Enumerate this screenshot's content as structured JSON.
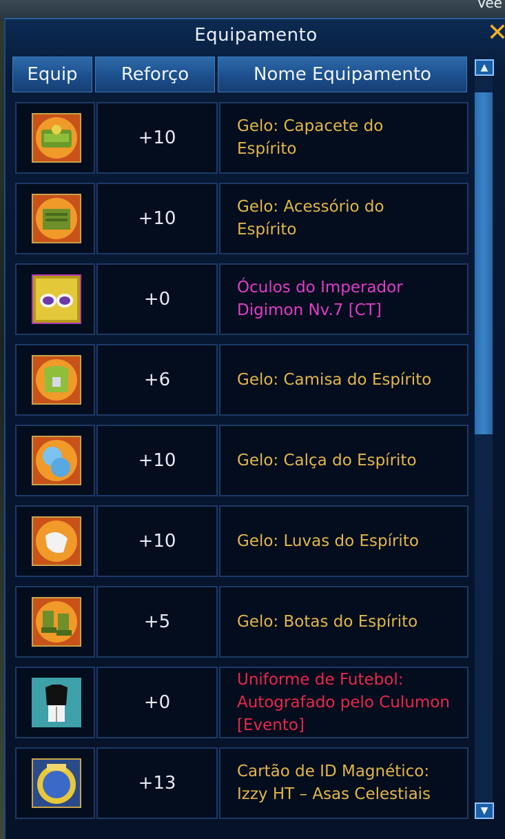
{
  "window": {
    "title": "Equipamento",
    "close_icon": "close-icon"
  },
  "background": {
    "peek_text": "Vee"
  },
  "headers": {
    "equip": "Equip",
    "reforco": "Reforço",
    "nome": "Nome Equipamento"
  },
  "colors": {
    "normal": "#e1b64a",
    "magenta": "#e23cc8",
    "red": "#e8284a",
    "enhance": "#e8ecf2",
    "header_bg": "#1c4f8d",
    "title": "#e9eef6",
    "close": "#f1b02a"
  },
  "items": [
    {
      "icon": "helmet-icon",
      "reforco": "+10",
      "lines": [
        "Gelo: Capacete do",
        "Espírito"
      ],
      "color": "normal"
    },
    {
      "icon": "accessory-icon",
      "reforco": "+10",
      "lines": [
        "Gelo: Acessório do",
        "Espírito"
      ],
      "color": "normal"
    },
    {
      "icon": "goggles-icon",
      "reforco": "+0",
      "lines": [
        "Óculos do Imperador",
        "Digimon Nv.7 [CT]"
      ],
      "color": "magenta"
    },
    {
      "icon": "shirt-icon",
      "reforco": "+6",
      "lines": [
        "Gelo: Camisa do Espírito"
      ],
      "color": "normal"
    },
    {
      "icon": "pants-icon",
      "reforco": "+10",
      "lines": [
        "Gelo: Calça do Espírito"
      ],
      "color": "normal"
    },
    {
      "icon": "gloves-icon",
      "reforco": "+10",
      "lines": [
        "Gelo: Luvas do Espírito"
      ],
      "color": "normal"
    },
    {
      "icon": "boots-icon",
      "reforco": "+5",
      "lines": [
        "Gelo: Botas do Espírito"
      ],
      "color": "normal"
    },
    {
      "icon": "football-uniform-icon",
      "reforco": "+0",
      "lines": [
        "Uniforme de Futebol:",
        "Autografado pelo Culumon",
        "[Evento]"
      ],
      "color": "red"
    },
    {
      "icon": "id-card-icon",
      "reforco": "+13",
      "lines": [
        "Cartão de ID Magnético:",
        "Izzy HT – Asas Celestiais"
      ],
      "color": "normal"
    }
  ],
  "scrollbar": {
    "up_icon": "scroll-up-icon",
    "down_icon": "scroll-down-icon",
    "position": 0
  }
}
